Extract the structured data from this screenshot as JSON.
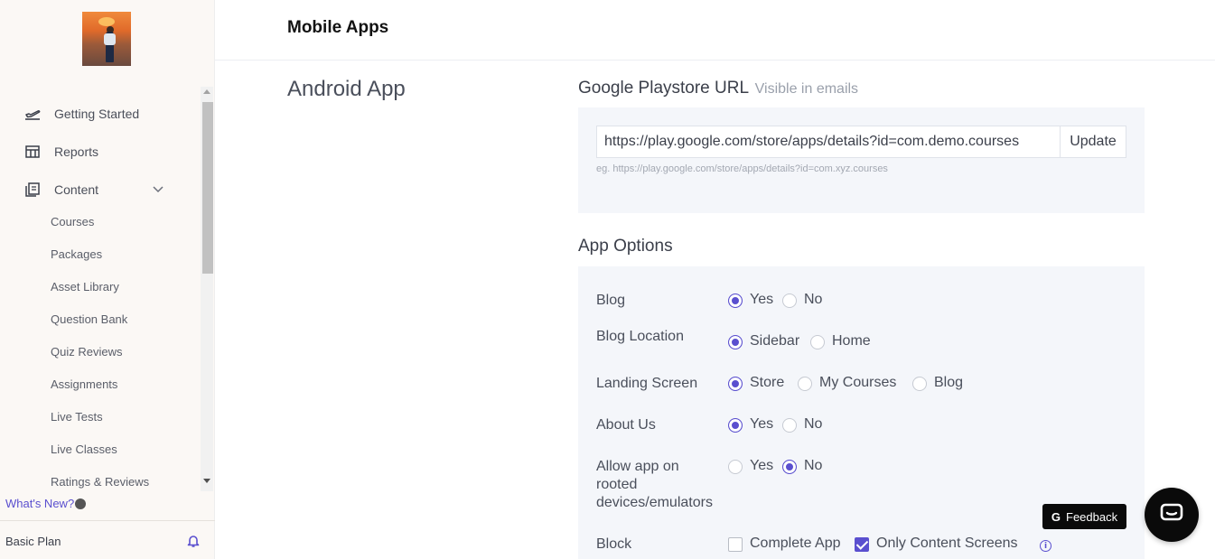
{
  "header": {
    "title": "Mobile Apps"
  },
  "sidebar": {
    "avatar_alt": "profile photo",
    "items": [
      {
        "label": "Getting Started",
        "icon": "takeoff-icon"
      },
      {
        "label": "Reports",
        "icon": "table-icon"
      },
      {
        "label": "Content",
        "icon": "library-icon",
        "expanded": true
      }
    ],
    "content_sub_items": [
      "Courses",
      "Packages",
      "Asset Library",
      "Question Bank",
      "Quiz Reviews",
      "Assignments",
      "Live Tests",
      "Live Classes",
      "Ratings & Reviews"
    ],
    "whats_new": "What's New?",
    "plan": "Basic Plan"
  },
  "main": {
    "section_title": "Android App",
    "playstore": {
      "heading": "Google Playstore URL",
      "hint": "Visible in emails",
      "value": "https://play.google.com/store/apps/details?id=com.demo.courses",
      "update_label": "Update",
      "example": "eg. https://play.google.com/store/apps/details?id=com.xyz.courses"
    },
    "options": {
      "heading": "App Options",
      "blog": {
        "label": "Blog",
        "choices": [
          "Yes",
          "No"
        ],
        "selected": "Yes"
      },
      "blog_location": {
        "label": "Blog Location",
        "choices": [
          "Sidebar",
          "Home"
        ],
        "selected": "Sidebar"
      },
      "landing_screen": {
        "label": "Landing Screen",
        "choices": [
          "Store",
          "My Courses",
          "Blog"
        ],
        "selected": "Store"
      },
      "about_us": {
        "label": "About Us",
        "choices": [
          "Yes",
          "No"
        ],
        "selected": "Yes"
      },
      "rooted": {
        "label_line1": "Allow app on",
        "label_line2": "rooted",
        "label_line3": "devices/emulators",
        "choices": [
          "Yes",
          "No"
        ],
        "selected": "No"
      },
      "block": {
        "label": "Block",
        "choices": [
          "Complete App",
          "Only Content Screens"
        ],
        "checked": [
          "Only Content Screens"
        ]
      }
    }
  },
  "floating": {
    "feedback_label": "Feedback",
    "feedback_glyph": "G"
  },
  "colors": {
    "accent": "#5a4fcf",
    "sidebar_bg": "#fbf8f5",
    "panel_bg": "#f4f6fa"
  }
}
